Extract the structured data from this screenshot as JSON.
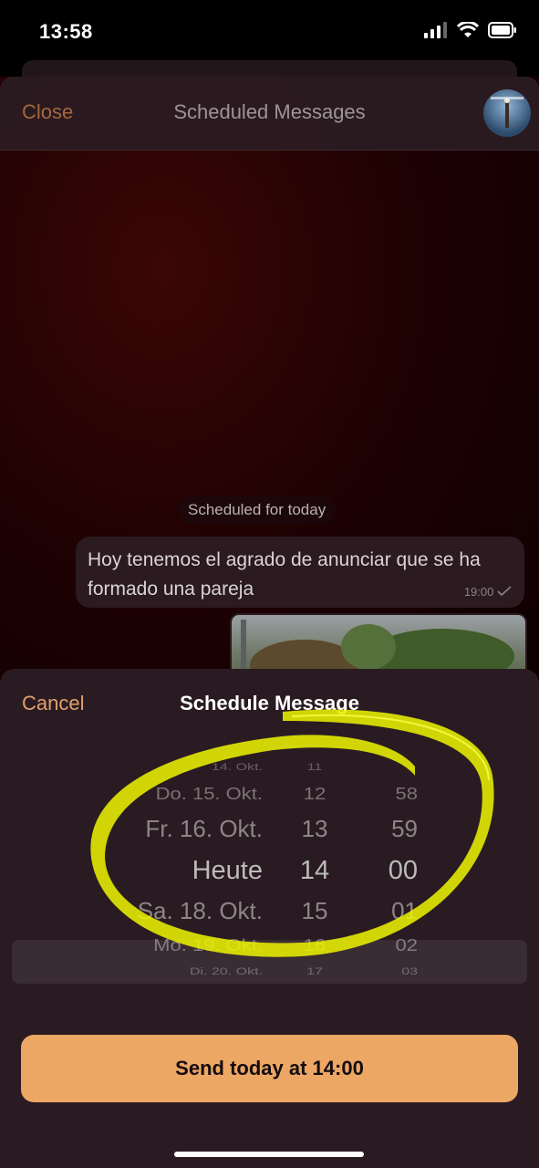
{
  "status": {
    "time": "13:58"
  },
  "nav": {
    "close": "Close",
    "title": "Scheduled Messages"
  },
  "chat": {
    "date_pill": "Scheduled for today",
    "message_text": "Hoy tenemos el agrado de anunciar que se ha formado una pareja",
    "message_time": "19:00",
    "check_icon": "checkmark-icon"
  },
  "sheet": {
    "cancel": "Cancel",
    "title": "Schedule Message",
    "rows": [
      {
        "date": "14. Okt.",
        "hour": "11",
        "minute": ""
      },
      {
        "date": "Do. 15. Okt.",
        "hour": "12",
        "minute": "58"
      },
      {
        "date": "Fr. 16. Okt.",
        "hour": "13",
        "minute": "59"
      },
      {
        "date": "Heute",
        "hour": "14",
        "minute": "00"
      },
      {
        "date": "Sa. 18. Okt.",
        "hour": "15",
        "minute": "01"
      },
      {
        "date": "Mo. 19. Okt.",
        "hour": "16",
        "minute": "02"
      },
      {
        "date": "Di. 20. Okt.",
        "hour": "17",
        "minute": "03"
      }
    ],
    "send_button": "Send today at 14:00"
  },
  "colors": {
    "accent": "#eca764",
    "cancel": "#e0a06a",
    "highlight": "#f2f200"
  }
}
